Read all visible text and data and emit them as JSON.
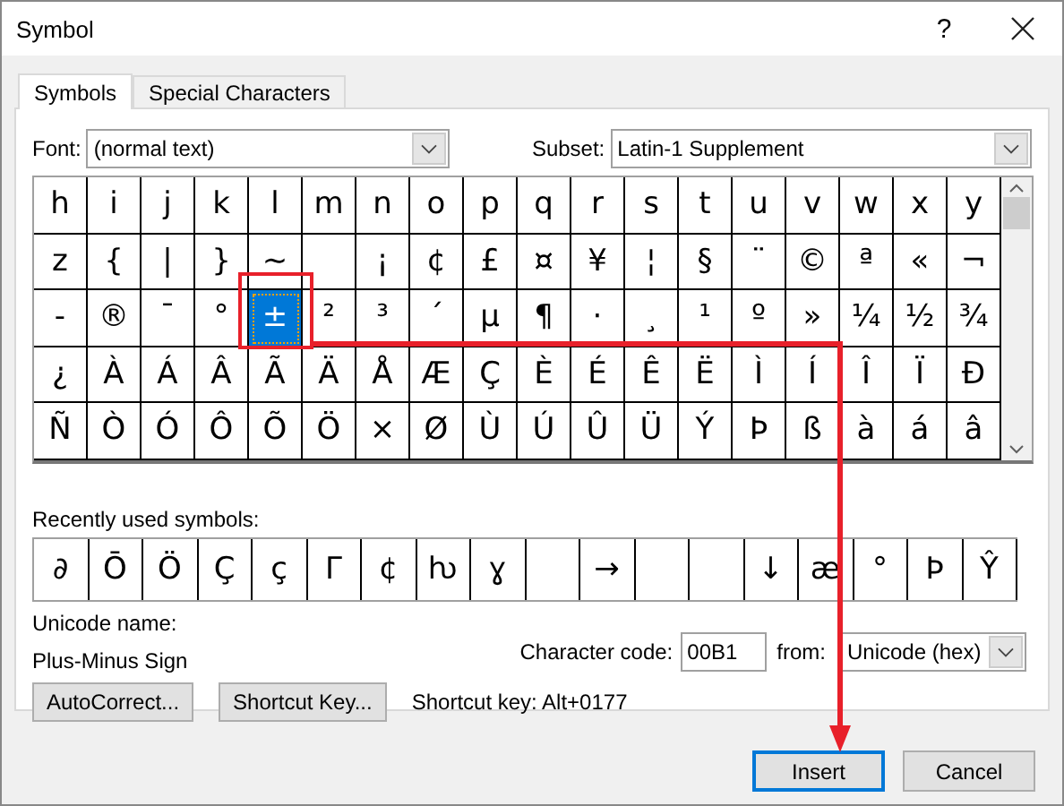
{
  "window": {
    "title": "Symbol",
    "help": "?"
  },
  "tabs": [
    {
      "label": "Symbols",
      "selected": true
    },
    {
      "label": "Special Characters",
      "selected": false
    }
  ],
  "font": {
    "label": "Font:",
    "value": "(normal text)"
  },
  "subset": {
    "label": "Subset:",
    "value": "Latin-1 Supplement"
  },
  "symbol_grid": [
    [
      {
        "char": "h",
        "selected": false
      },
      {
        "char": "i",
        "selected": false
      },
      {
        "char": "j",
        "selected": false
      },
      {
        "char": "k",
        "selected": false
      },
      {
        "char": "l",
        "selected": false
      },
      {
        "char": "m",
        "selected": false
      },
      {
        "char": "n",
        "selected": false
      },
      {
        "char": "o",
        "selected": false
      },
      {
        "char": "p",
        "selected": false
      },
      {
        "char": "q",
        "selected": false
      },
      {
        "char": "r",
        "selected": false
      },
      {
        "char": "s",
        "selected": false
      },
      {
        "char": "t",
        "selected": false
      },
      {
        "char": "u",
        "selected": false
      },
      {
        "char": "v",
        "selected": false
      },
      {
        "char": "w",
        "selected": false
      },
      {
        "char": "x",
        "selected": false
      },
      {
        "char": "y",
        "selected": false
      }
    ],
    [
      {
        "char": "z",
        "selected": false
      },
      {
        "char": "{",
        "selected": false
      },
      {
        "char": "|",
        "selected": false
      },
      {
        "char": "}",
        "selected": false
      },
      {
        "char": "~",
        "selected": false
      },
      {
        "selected": false
      },
      {
        "char": "¡",
        "selected": false
      },
      {
        "char": "¢",
        "selected": false
      },
      {
        "char": "£",
        "selected": false
      },
      {
        "char": "¤",
        "selected": false
      },
      {
        "char": "¥",
        "selected": false
      },
      {
        "char": "¦",
        "selected": false
      },
      {
        "char": "§",
        "selected": false
      },
      {
        "char": "¨",
        "selected": false
      },
      {
        "char": "©",
        "selected": false
      },
      {
        "char": "ª",
        "selected": false
      },
      {
        "char": "«",
        "selected": false
      },
      {
        "char": "¬",
        "selected": false
      }
    ],
    [
      {
        "char": "-",
        "selected": false
      },
      {
        "char": "®",
        "selected": false
      },
      {
        "char": "¯",
        "selected": false
      },
      {
        "char": "°",
        "selected": false
      },
      {
        "char": "±",
        "selected": true
      },
      {
        "char": "²",
        "selected": false
      },
      {
        "char": "³",
        "selected": false
      },
      {
        "char": "´",
        "selected": false
      },
      {
        "char": "µ",
        "selected": false
      },
      {
        "char": "¶",
        "selected": false
      },
      {
        "char": "·",
        "selected": false
      },
      {
        "char": "¸",
        "selected": false
      },
      {
        "char": "¹",
        "selected": false
      },
      {
        "char": "º",
        "selected": false
      },
      {
        "char": "»",
        "selected": false
      },
      {
        "char": "¼",
        "selected": false
      },
      {
        "char": "½",
        "selected": false
      },
      {
        "char": "¾",
        "selected": false
      }
    ],
    [
      {
        "char": "¿",
        "selected": false
      },
      {
        "char": "À",
        "selected": false
      },
      {
        "char": "Á",
        "selected": false
      },
      {
        "char": "Â",
        "selected": false
      },
      {
        "char": "Ã",
        "selected": false
      },
      {
        "char": "Ä",
        "selected": false
      },
      {
        "char": "Å",
        "selected": false
      },
      {
        "char": "Æ",
        "selected": false
      },
      {
        "char": "Ç",
        "selected": false
      },
      {
        "char": "È",
        "selected": false
      },
      {
        "char": "É",
        "selected": false
      },
      {
        "char": "Ê",
        "selected": false
      },
      {
        "char": "Ë",
        "selected": false
      },
      {
        "char": "Ì",
        "selected": false
      },
      {
        "char": "Í",
        "selected": false
      },
      {
        "char": "Î",
        "selected": false
      },
      {
        "char": "Ï",
        "selected": false
      },
      {
        "char": "Ð",
        "selected": false
      }
    ],
    [
      {
        "char": "Ñ",
        "selected": false
      },
      {
        "char": "Ò",
        "selected": false
      },
      {
        "char": "Ó",
        "selected": false
      },
      {
        "char": "Ô",
        "selected": false
      },
      {
        "char": "Õ",
        "selected": false
      },
      {
        "char": "Ö",
        "selected": false
      },
      {
        "char": "×",
        "selected": false
      },
      {
        "char": "Ø",
        "selected": false
      },
      {
        "char": "Ù",
        "selected": false
      },
      {
        "char": "Ú",
        "selected": false
      },
      {
        "char": "Û",
        "selected": false
      },
      {
        "char": "Ü",
        "selected": false
      },
      {
        "char": "Ý",
        "selected": false
      },
      {
        "char": "Þ",
        "selected": false
      },
      {
        "char": "ß",
        "selected": false
      },
      {
        "char": "à",
        "selected": false
      },
      {
        "char": "á",
        "selected": false
      },
      {
        "char": "â",
        "selected": false
      }
    ]
  ],
  "recently_used": {
    "label": "Recently used symbols:",
    "symbols": [
      {
        "kind": "symbol",
        "char": "∂"
      },
      {
        "kind": "symbol",
        "char": "Ō"
      },
      {
        "kind": "symbol",
        "char": "Ö"
      },
      {
        "kind": "symbol",
        "char": "Ç"
      },
      {
        "kind": "symbol",
        "char": "ç"
      },
      {
        "kind": "symbol",
        "char": "Γ"
      },
      {
        "kind": "symbol",
        "char": "¢"
      },
      {
        "kind": "symbol",
        "char": "ƕ"
      },
      {
        "kind": "symbol",
        "char": "ɣ"
      },
      {
        "kind": "blank"
      },
      {
        "kind": "symbol",
        "char": "→"
      },
      {
        "kind": "blank"
      },
      {
        "kind": "blank"
      },
      {
        "kind": "symbol",
        "char": "↓"
      },
      {
        "kind": "symbol",
        "char": "æ"
      },
      {
        "kind": "symbol",
        "char": "°"
      },
      {
        "kind": "symbol",
        "char": "Þ"
      },
      {
        "kind": "symbol",
        "char": "Ŷ"
      }
    ]
  },
  "unicode_name": {
    "label": "Unicode name:",
    "value": "Plus-Minus Sign"
  },
  "character_code": {
    "label": "Character code:",
    "value": "00B1"
  },
  "from": {
    "label": "from:",
    "value": "Unicode (hex)"
  },
  "tool_buttons": [
    {
      "label": "AutoCorrect..."
    },
    {
      "label": "Shortcut Key..."
    }
  ],
  "shortcut_key": "Shortcut key: Alt+0177",
  "buttons": [
    {
      "label": "Insert",
      "default": true
    },
    {
      "label": "Cancel",
      "default": false
    }
  ]
}
